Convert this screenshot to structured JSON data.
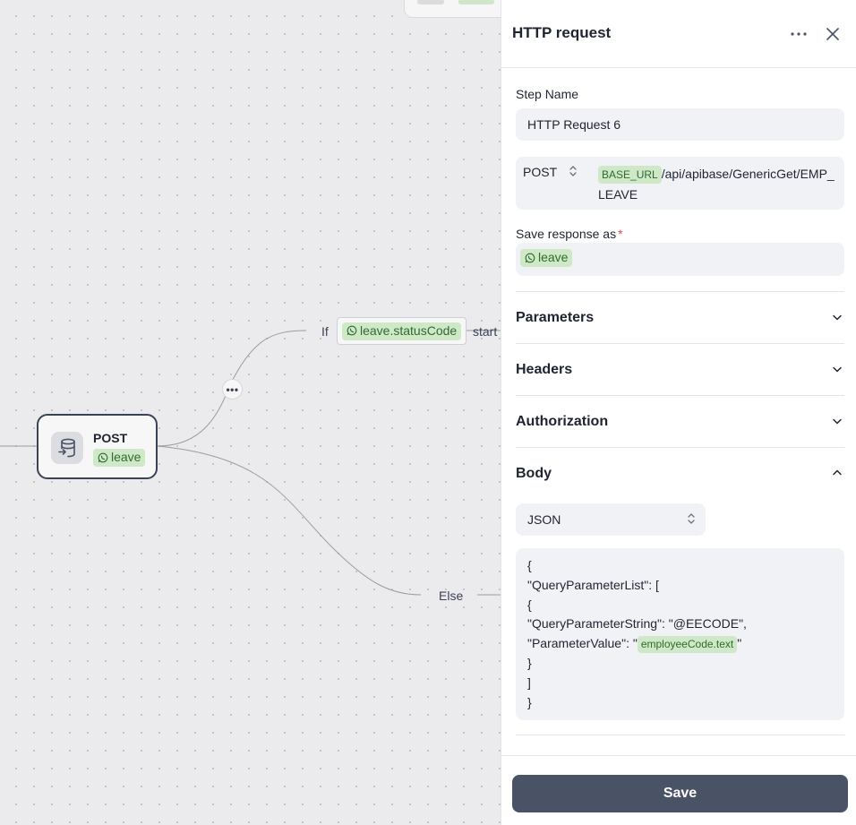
{
  "canvas": {
    "node": {
      "title": "POST",
      "variable": "leave"
    },
    "edges": {
      "menu_glyph": "•••",
      "if_label": "If",
      "condition_variable": "leave.statusCode",
      "condition_operator": "start",
      "else_label": "Else"
    }
  },
  "panel": {
    "title": "HTTP request",
    "step_name": {
      "label": "Step Name",
      "value": "HTTP Request 6"
    },
    "request": {
      "method": "POST",
      "url_variable": "BASE_URL",
      "url_path": "/api/apibase/GenericGet/EMP_LEAVE"
    },
    "save_response": {
      "label": "Save response as",
      "required_mark": "*",
      "variable": "leave"
    },
    "sections": {
      "parameters": "Parameters",
      "headers": "Headers",
      "authorization": "Authorization",
      "body": "Body"
    },
    "body": {
      "format": "JSON",
      "lines": [
        "{",
        "\"QueryParameterList\": [",
        "{",
        "\"QueryParameterString\": \"@EECODE\","
      ],
      "param_value_prefix": "\"ParameterValue\": \"",
      "param_value_variable": "employeeCode.text",
      "param_value_suffix": "\"",
      "closing_lines": [
        "}",
        "]",
        "}"
      ]
    },
    "save_label": "Save"
  },
  "colors": {
    "variable_chip_bg": "#cfe9c8",
    "variable_chip_text": "#2f6b2c",
    "save_button": "#4a5366",
    "node_border": "#3b4254",
    "required": "#e5484d"
  },
  "icons": [
    "database-icon",
    "whatsapp-icon",
    "more-icon",
    "close-icon",
    "chevron-down-icon",
    "chevron-up-icon",
    "updown-icon"
  ]
}
